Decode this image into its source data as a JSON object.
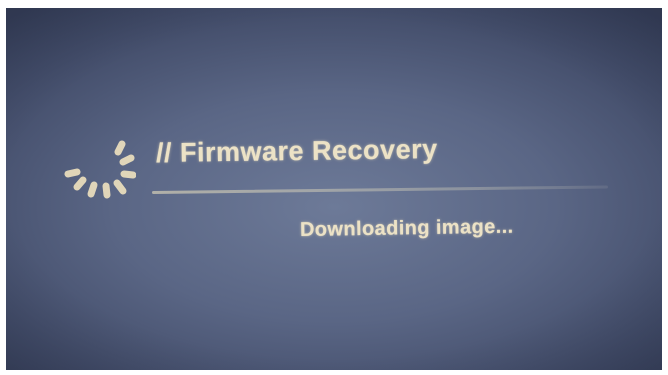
{
  "recovery": {
    "title": "// Firmware Recovery",
    "status": "Downloading image..."
  },
  "icons": {
    "spinner": "loading-spinner-icon"
  },
  "colors": {
    "text": "#ece2c6",
    "background": "#5a6685"
  }
}
